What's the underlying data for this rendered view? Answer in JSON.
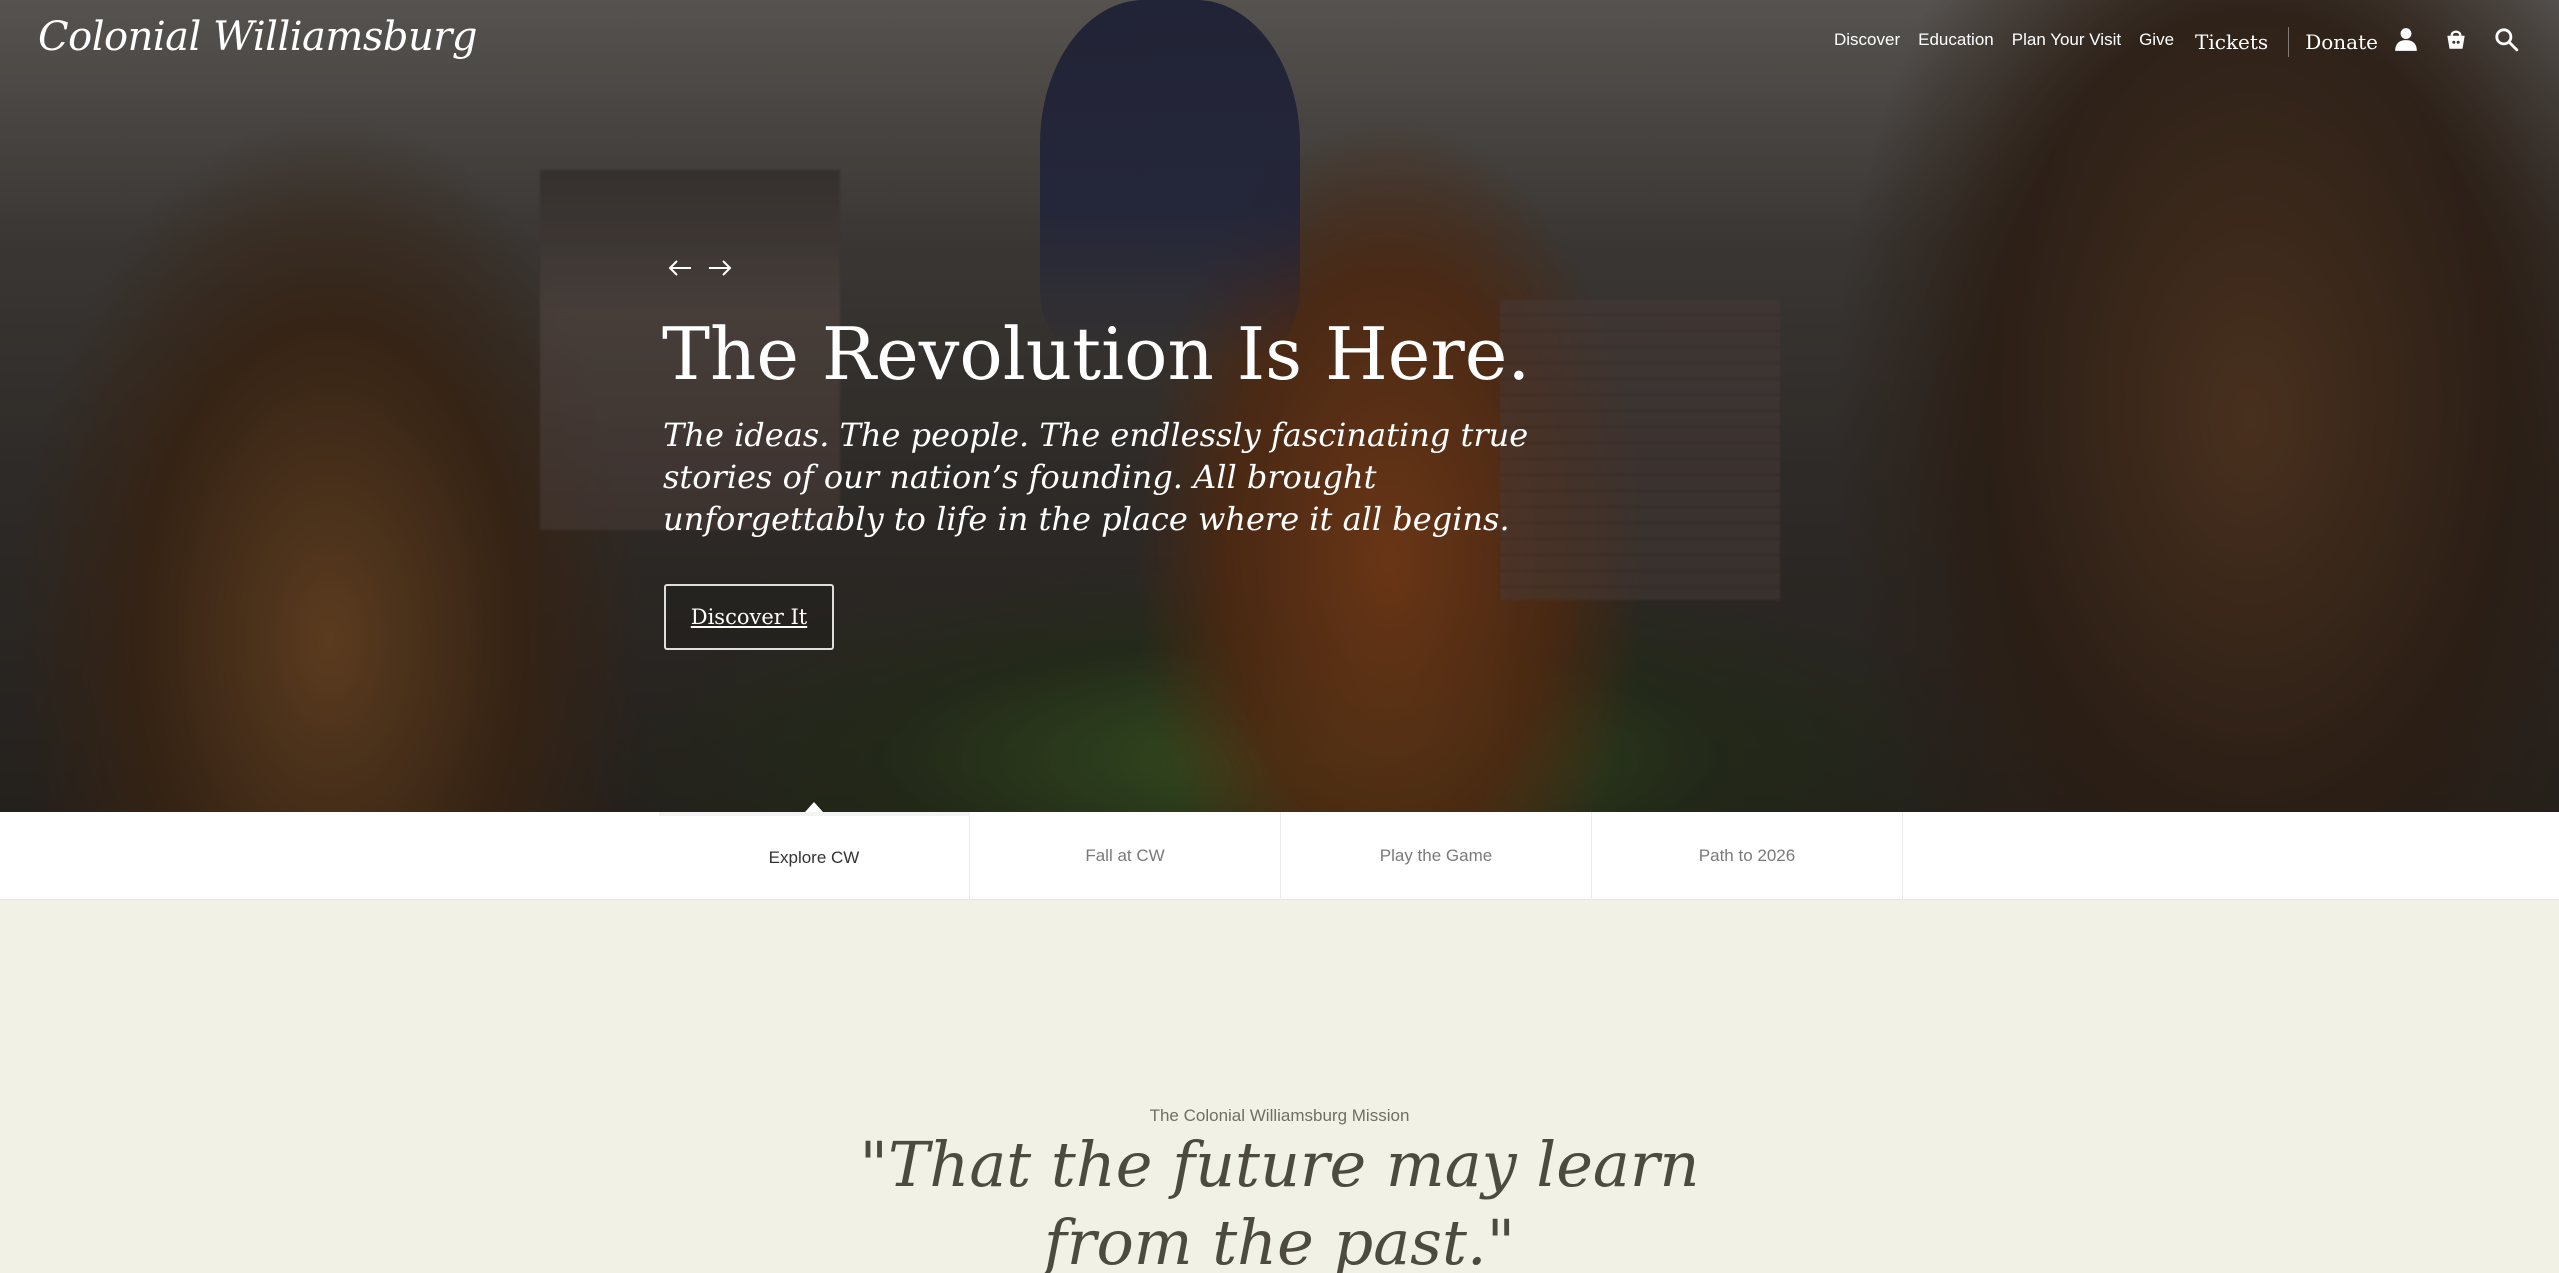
{
  "header": {
    "logo_text": "Colonial Williamsburg",
    "nav": [
      "Discover",
      "Education",
      "Plan Your Visit",
      "Give"
    ],
    "tickets": "Tickets",
    "donate": "Donate",
    "icons": [
      "account-icon",
      "basket-icon",
      "search-icon"
    ]
  },
  "hero": {
    "headline": "The Revolution Is Here.",
    "subtext": "The ideas. The people. The endlessly fascinating true stories of our nation’s founding. All brought unforgettably to life in the place where it all begins.",
    "cta": "Discover It"
  },
  "tabs": [
    {
      "label": "Explore CW",
      "active": true
    },
    {
      "label": "Fall at CW",
      "active": false
    },
    {
      "label": "Play the Game",
      "active": false
    },
    {
      "label": "Path to 2026",
      "active": false
    }
  ],
  "mission": {
    "label": "The Colonial Williamsburg Mission",
    "quote_line1": "\"That the future may learn",
    "quote_line2": "from the past.\""
  },
  "colors": {
    "background": "#f1f1e6",
    "text_dark": "#4d4a3f",
    "tab_bar": "#ffffff"
  }
}
